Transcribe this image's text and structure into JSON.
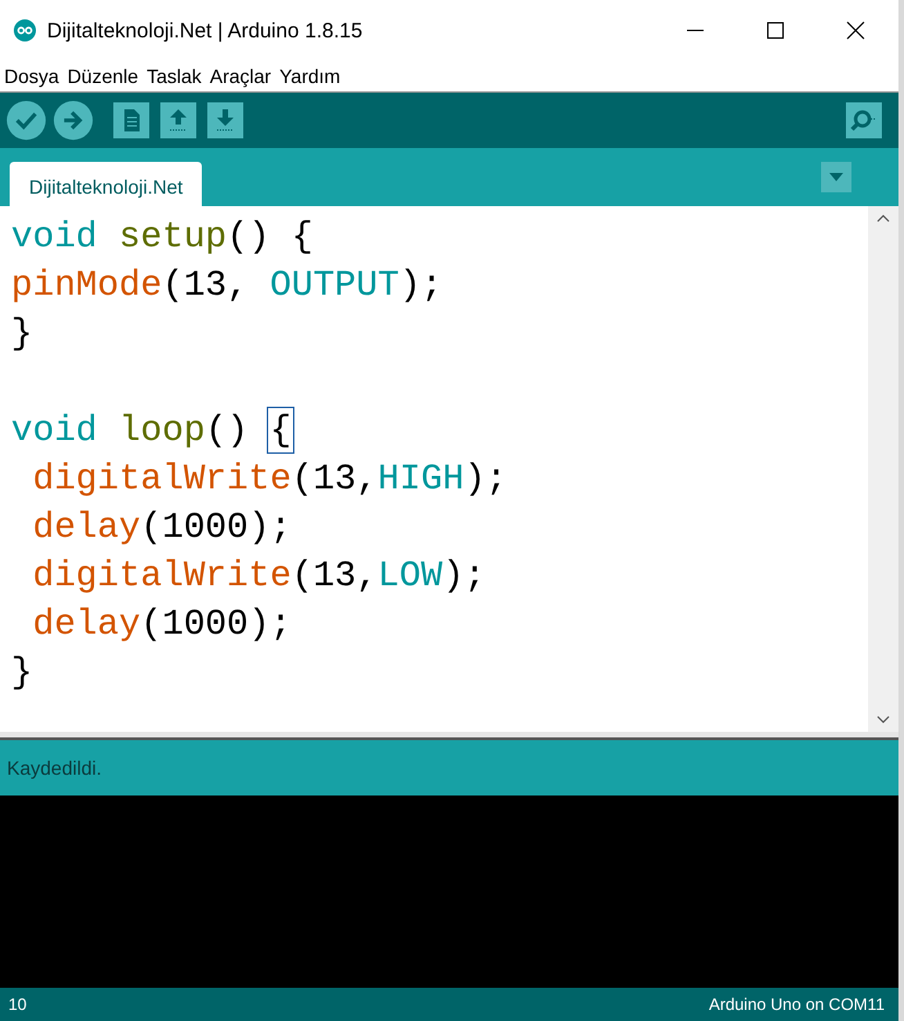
{
  "window": {
    "title": "Dijitalteknoloji.Net | Arduino 1.8.15"
  },
  "menu": [
    "Dosya",
    "Düzenle",
    "Taslak",
    "Araçlar",
    "Yardım"
  ],
  "tabs": [
    {
      "label": "Dijitalteknoloji.Net",
      "selected": true
    }
  ],
  "editor": {
    "lines": [
      {
        "kind": "code",
        "tokens": [
          {
            "text": "void ",
            "kind": "keyword"
          },
          {
            "text": "setup",
            "kind": "name"
          },
          {
            "text": "() {",
            "kind": "plain"
          }
        ]
      },
      {
        "kind": "code",
        "tokens": [
          {
            "text": "pinMode",
            "kind": "function"
          },
          {
            "text": "(13, ",
            "kind": "plain"
          },
          {
            "text": "OUTPUT",
            "kind": "constant"
          },
          {
            "text": ");",
            "kind": "plain"
          }
        ]
      },
      {
        "kind": "code",
        "tokens": [
          {
            "text": "}",
            "kind": "plain"
          }
        ]
      },
      {
        "kind": "blank"
      },
      {
        "kind": "code",
        "tokens": [
          {
            "text": "void ",
            "kind": "keyword"
          },
          {
            "text": "loop",
            "kind": "name"
          },
          {
            "text": "() ",
            "kind": "plain"
          },
          {
            "text": "{",
            "kind": "matched"
          }
        ]
      },
      {
        "kind": "code",
        "tokens": [
          {
            "text": " digitalWrite",
            "kind": "function"
          },
          {
            "text": "(13,",
            "kind": "plain"
          },
          {
            "text": "HIGH",
            "kind": "constant"
          },
          {
            "text": ");",
            "kind": "plain"
          }
        ]
      },
      {
        "kind": "code",
        "tokens": [
          {
            "text": " delay",
            "kind": "function"
          },
          {
            "text": "(1000);",
            "kind": "plain"
          }
        ]
      },
      {
        "kind": "code",
        "tokens": [
          {
            "text": " digitalWrite",
            "kind": "function"
          },
          {
            "text": "(13,",
            "kind": "plain"
          },
          {
            "text": "LOW",
            "kind": "constant"
          },
          {
            "text": ");",
            "kind": "plain"
          }
        ]
      },
      {
        "kind": "code",
        "tokens": [
          {
            "text": " delay",
            "kind": "function"
          },
          {
            "text": "(1000);",
            "kind": "plain"
          }
        ]
      },
      {
        "kind": "code",
        "tokens": [
          {
            "text": "}",
            "kind": "plain"
          }
        ]
      }
    ]
  },
  "message": "Kaydedildi.",
  "status_bar": {
    "line": "10",
    "board": "Arduino Uno on COM11"
  }
}
